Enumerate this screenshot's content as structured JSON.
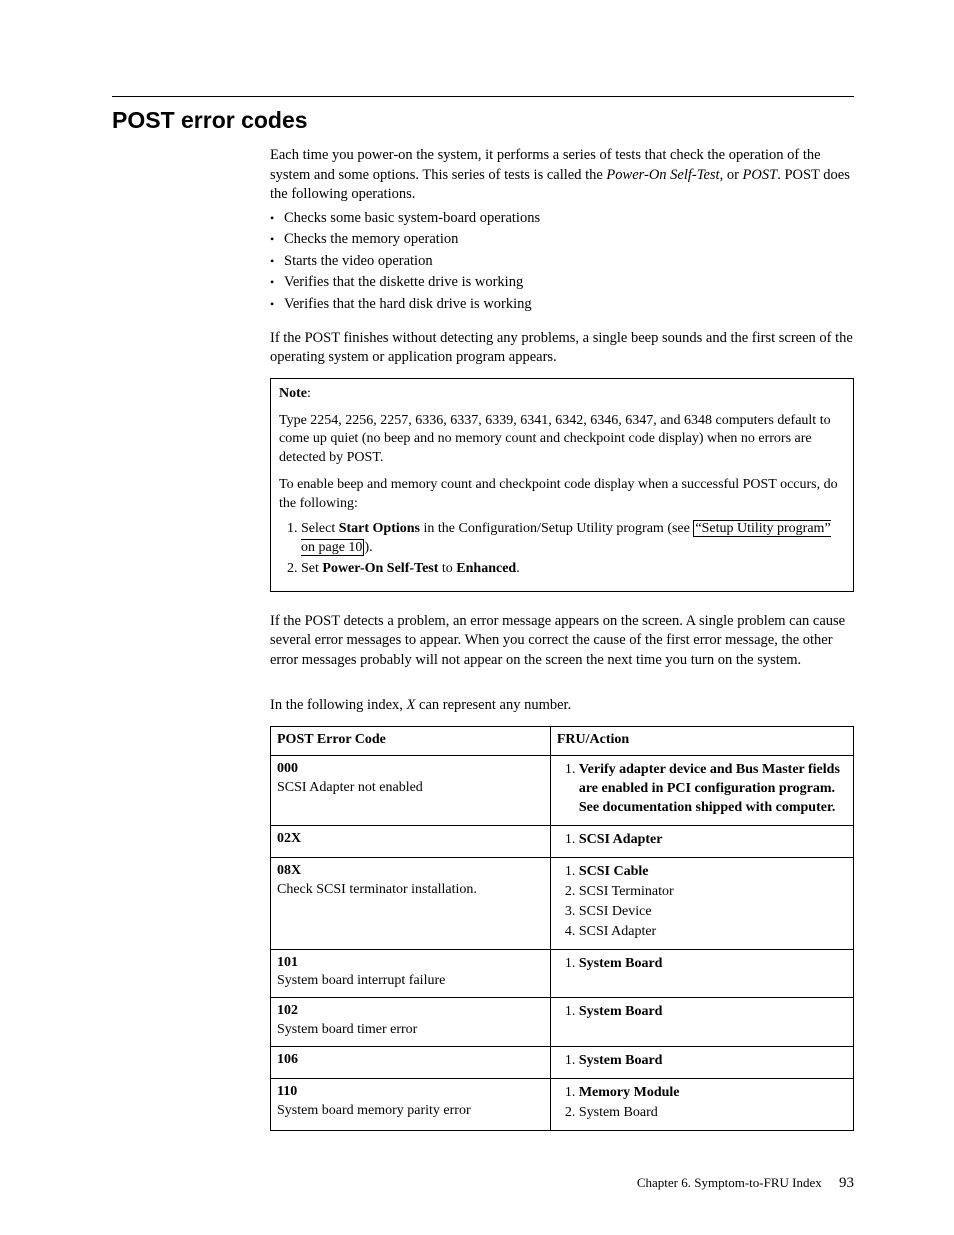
{
  "heading": "POST error codes",
  "intro": {
    "p1_a": "Each time you power-on the system, it performs a series of tests that check the operation of the system and some options. This series of tests is called the ",
    "p1_i": "Power-On Self-Test",
    "p1_b": ", or ",
    "p1_i2": "POST",
    "p1_c": ". POST does the following operations.",
    "bullets": [
      "Checks some basic system-board operations",
      "Checks the memory operation",
      "Starts the video operation",
      "Verifies that the diskette drive is working",
      "Verifies that the hard disk drive is working"
    ],
    "p2": "If the POST finishes without detecting any problems, a single beep sounds and the first screen of the operating system or application program appears."
  },
  "note": {
    "label": "Note",
    "colon": ":",
    "p1": "Type 2254, 2256, 2257, 6336, 6337, 6339, 6341, 6342, 6346, 6347, and 6348 computers default to come up quiet (no beep and no memory count and checkpoint code display) when no errors are detected by POST.",
    "p2": "To enable beep and memory count and checkpoint code display when a successful POST occurs, do the following:",
    "li1_a": "Select ",
    "li1_b": "Start Options",
    "li1_c": " in the Configuration/Setup Utility program (see ",
    "li1_link": "“Setup Utility program” on page 10",
    "li1_d": ").",
    "li2_a": "Set ",
    "li2_b": "Power-On Self-Test",
    "li2_c": " to ",
    "li2_d": "Enhanced",
    "li2_e": "."
  },
  "after_note": {
    "p1": "If the POST detects a problem, an error message appears on the screen. A single problem can cause several error messages to appear. When you correct the cause of the first error message, the other error messages probably will not appear on the screen the next time you turn on the system.",
    "p2_a": "In the following index, ",
    "p2_i": "X",
    "p2_b": " can represent any number."
  },
  "table": {
    "h1": "POST Error Code",
    "h2": "FRU/Action",
    "rows": [
      {
        "code": "000",
        "desc": "SCSI Adapter not enabled",
        "actions": [
          {
            "text": "Verify adapter device and Bus Master fields are enabled in PCI configuration program. See documentation shipped with computer.",
            "bold": true
          }
        ]
      },
      {
        "code": "02X",
        "desc": "",
        "actions": [
          {
            "text": "SCSI Adapter",
            "bold": true
          }
        ]
      },
      {
        "code": "08X",
        "desc": "Check SCSI terminator installation.",
        "actions": [
          {
            "text": "SCSI Cable",
            "bold": true
          },
          {
            "text": "SCSI Terminator",
            "bold": false
          },
          {
            "text": "SCSI Device",
            "bold": false
          },
          {
            "text": "SCSI Adapter",
            "bold": false
          }
        ]
      },
      {
        "code": "101",
        "desc": "System board interrupt failure",
        "actions": [
          {
            "text": "System Board",
            "bold": true
          }
        ]
      },
      {
        "code": "102",
        "desc": "System board timer error",
        "actions": [
          {
            "text": "System Board",
            "bold": true
          }
        ]
      },
      {
        "code": "106",
        "desc": "",
        "actions": [
          {
            "text": "System Board",
            "bold": true
          }
        ]
      },
      {
        "code": "110",
        "desc": "System board memory parity error",
        "actions": [
          {
            "text": "Memory Module",
            "bold": true
          },
          {
            "text": "System Board",
            "bold": false
          }
        ]
      }
    ]
  },
  "footer": {
    "chapter": "Chapter 6. Symptom-to-FRU Index",
    "page": "93"
  }
}
